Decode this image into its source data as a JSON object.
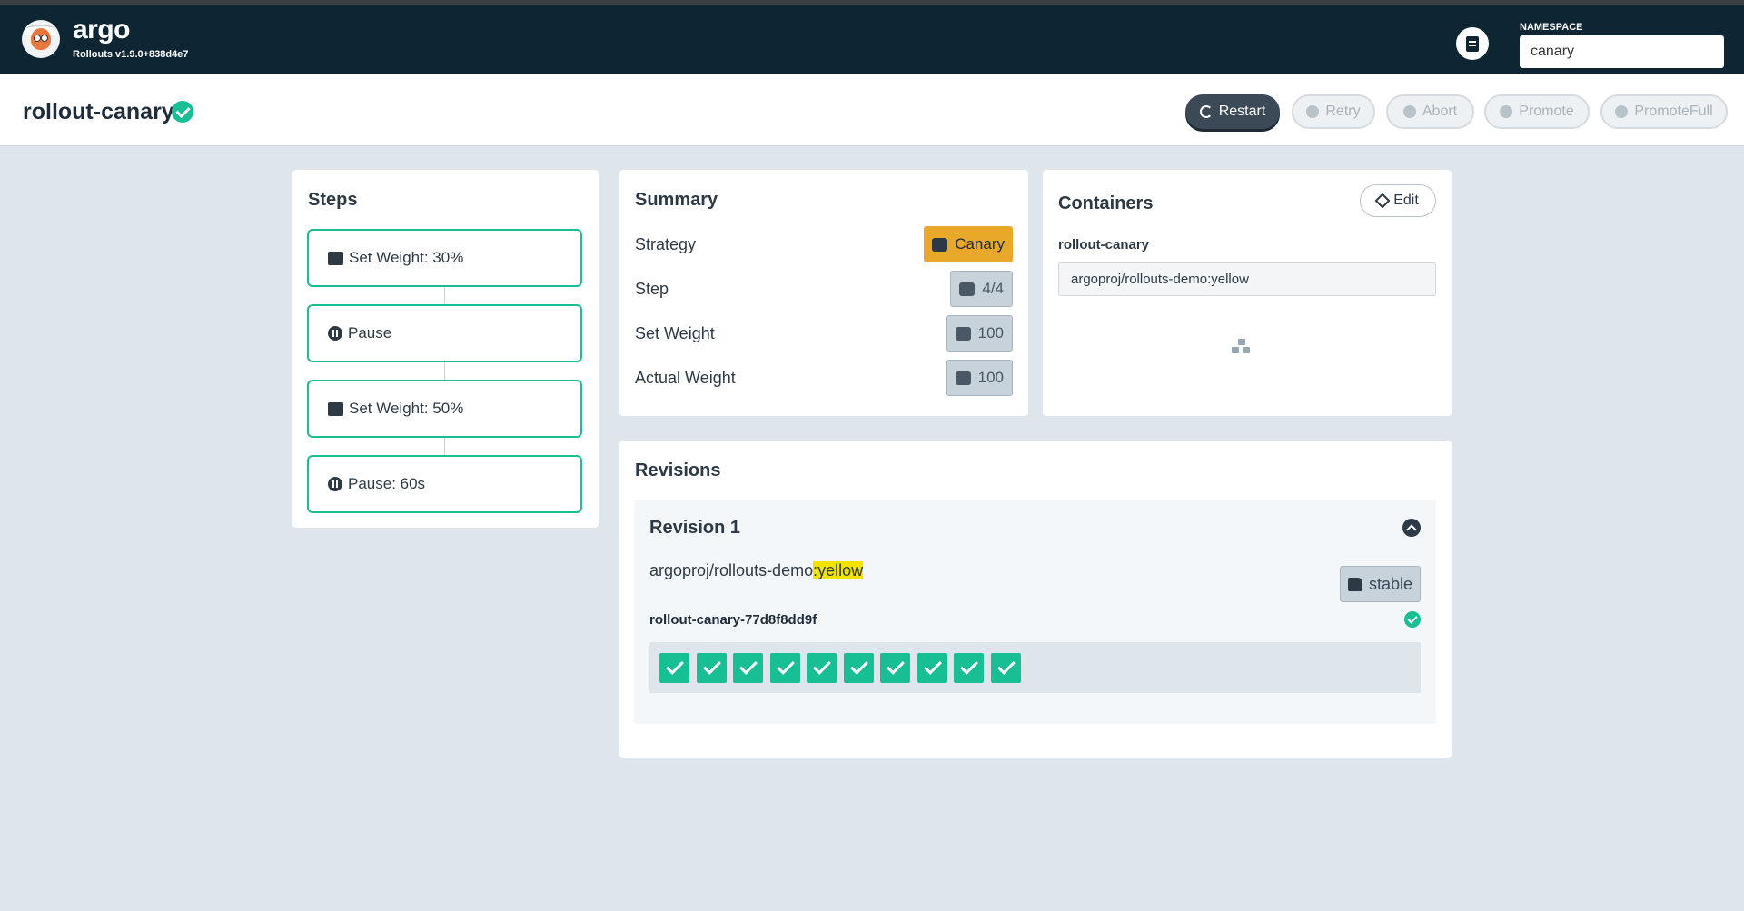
{
  "header": {
    "brand": "argo",
    "version": "Rollouts v1.9.0+838d4e7",
    "namespace_label": "NAMESPACE",
    "namespace_value": "canary"
  },
  "rollout": {
    "name": "rollout-canary",
    "status_icon": "check-circle-icon",
    "actions": {
      "restart": "Restart",
      "retry": "Retry",
      "abort": "Abort",
      "promote": "Promote",
      "promote_full": "PromoteFull"
    }
  },
  "steps": {
    "title": "Steps",
    "items": [
      {
        "label": "Set Weight: 30%",
        "icon": "weight-icon"
      },
      {
        "label": "Pause",
        "icon": "pause-icon"
      },
      {
        "label": "Set Weight: 50%",
        "icon": "weight-icon"
      },
      {
        "label": "Pause: 60s",
        "icon": "pause-icon"
      }
    ]
  },
  "summary": {
    "title": "Summary",
    "rows": [
      {
        "label": "Strategy",
        "value": "Canary",
        "icon": "bird-icon"
      },
      {
        "label": "Step",
        "value": "4/4",
        "icon": "shoe-prints-icon"
      },
      {
        "label": "Set Weight",
        "value": "100",
        "icon": "balance-scale-icon"
      },
      {
        "label": "Actual Weight",
        "value": "100",
        "icon": "balance-scale-icon"
      }
    ]
  },
  "containers": {
    "title": "Containers",
    "edit_label": "Edit",
    "name": "rollout-canary",
    "image": "argoproj/rollouts-demo:yellow"
  },
  "revisions": {
    "title": "Revisions",
    "items": [
      {
        "title": "Revision 1",
        "image_prefix": "argoproj/rollouts-demo",
        "image_tag": ":yellow",
        "badge": "stable",
        "replicaset": "rollout-canary-77d8f8dd9f",
        "pods_healthy": 10
      }
    ]
  },
  "colors": {
    "header_bg": "#0e2634",
    "accent_green": "#18be94",
    "canary_orange": "#e8a92b",
    "image_tag_highlight": "#f2e400"
  }
}
